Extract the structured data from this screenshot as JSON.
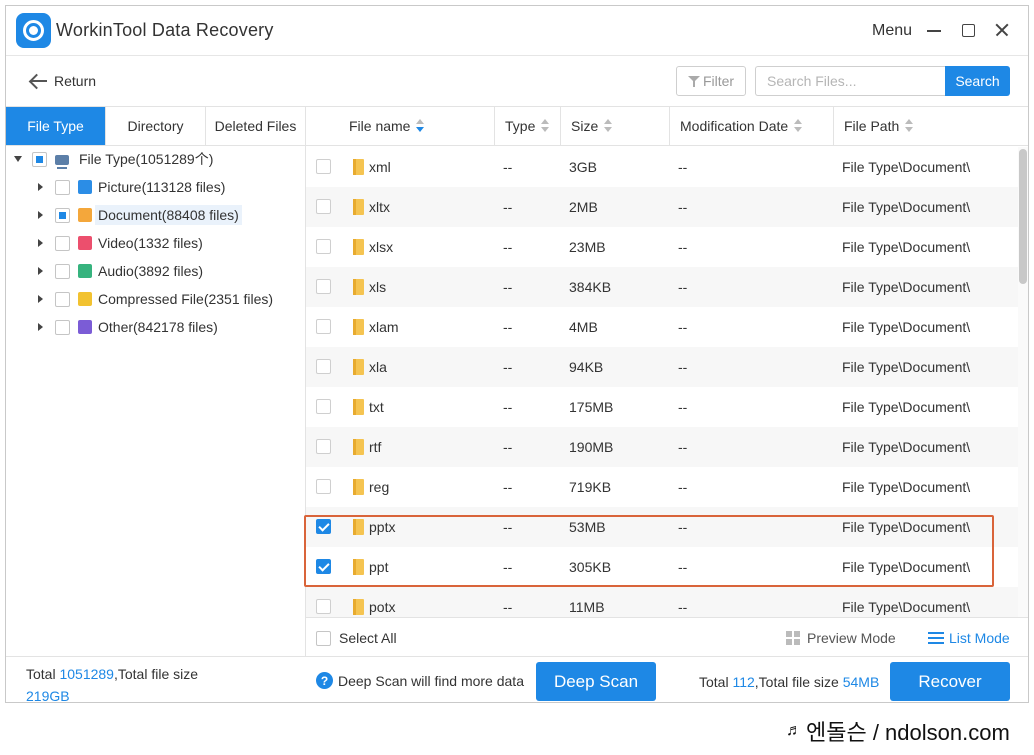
{
  "window": {
    "title": "WorkinTool Data Recovery",
    "menu_label": "Menu"
  },
  "toolbar": {
    "return_label": "Return",
    "filter_label": "Filter",
    "search_placeholder": "Search Files...",
    "search_label": "Search"
  },
  "left_tabs": [
    "File Type",
    "Directory",
    "Deleted Files"
  ],
  "tree": {
    "root": "File Type(1051289个)",
    "items": [
      {
        "label": "Picture(113128 files)",
        "icon": "picture-icon",
        "checked": "none"
      },
      {
        "label": "Document(88408 files)",
        "icon": "document-icon",
        "checked": "partial"
      },
      {
        "label": "Video(1332 files)",
        "icon": "video-icon",
        "checked": "none"
      },
      {
        "label": "Audio(3892 files)",
        "icon": "audio-icon",
        "checked": "none"
      },
      {
        "label": "Compressed File(2351 files)",
        "icon": "compressed-file-icon",
        "checked": "none"
      },
      {
        "label": "Other(842178 files)",
        "icon": "other-file-icon",
        "checked": "none"
      }
    ]
  },
  "table": {
    "columns": [
      "File name",
      "Type",
      "Size",
      "Modification Date",
      "File Path"
    ],
    "rows": [
      {
        "name": "xml",
        "type": "--",
        "size": "3GB",
        "date": "--",
        "path": "File Type\\Document\\",
        "checked": false
      },
      {
        "name": "xltx",
        "type": "--",
        "size": "2MB",
        "date": "--",
        "path": "File Type\\Document\\",
        "checked": false
      },
      {
        "name": "xlsx",
        "type": "--",
        "size": "23MB",
        "date": "--",
        "path": "File Type\\Document\\",
        "checked": false
      },
      {
        "name": "xls",
        "type": "--",
        "size": "384KB",
        "date": "--",
        "path": "File Type\\Document\\",
        "checked": false
      },
      {
        "name": "xlam",
        "type": "--",
        "size": "4MB",
        "date": "--",
        "path": "File Type\\Document\\",
        "checked": false
      },
      {
        "name": "xla",
        "type": "--",
        "size": "94KB",
        "date": "--",
        "path": "File Type\\Document\\",
        "checked": false
      },
      {
        "name": "txt",
        "type": "--",
        "size": "175MB",
        "date": "--",
        "path": "File Type\\Document\\",
        "checked": false
      },
      {
        "name": "rtf",
        "type": "--",
        "size": "190MB",
        "date": "--",
        "path": "File Type\\Document\\",
        "checked": false
      },
      {
        "name": "reg",
        "type": "--",
        "size": "719KB",
        "date": "--",
        "path": "File Type\\Document\\",
        "checked": false
      },
      {
        "name": "pptx",
        "type": "--",
        "size": "53MB",
        "date": "--",
        "path": "File Type\\Document\\",
        "checked": true
      },
      {
        "name": "ppt",
        "type": "--",
        "size": "305KB",
        "date": "--",
        "path": "File Type\\Document\\",
        "checked": true
      },
      {
        "name": "potx",
        "type": "--",
        "size": "11MB",
        "date": "--",
        "path": "File Type\\Document\\",
        "checked": false
      }
    ]
  },
  "footer": {
    "select_all": "Select All",
    "preview_mode": "Preview Mode",
    "list_mode": "List Mode"
  },
  "bottom": {
    "total_prefix": "Total ",
    "total_count": "1051289",
    "total_mid": ",Total file size",
    "total_size": "219GB",
    "deep_hint": "Deep Scan will find more data",
    "deep_scan_label": "Deep Scan",
    "sel_prefix": "Total ",
    "sel_count": "112",
    "sel_mid": ",Total file size ",
    "sel_size": "54MB",
    "recover_label": "Recover"
  },
  "watermark": "엔돌슨 / ndolson.com",
  "colors": {
    "accent": "#1e88e5",
    "highlight_box": "#d9643a"
  }
}
